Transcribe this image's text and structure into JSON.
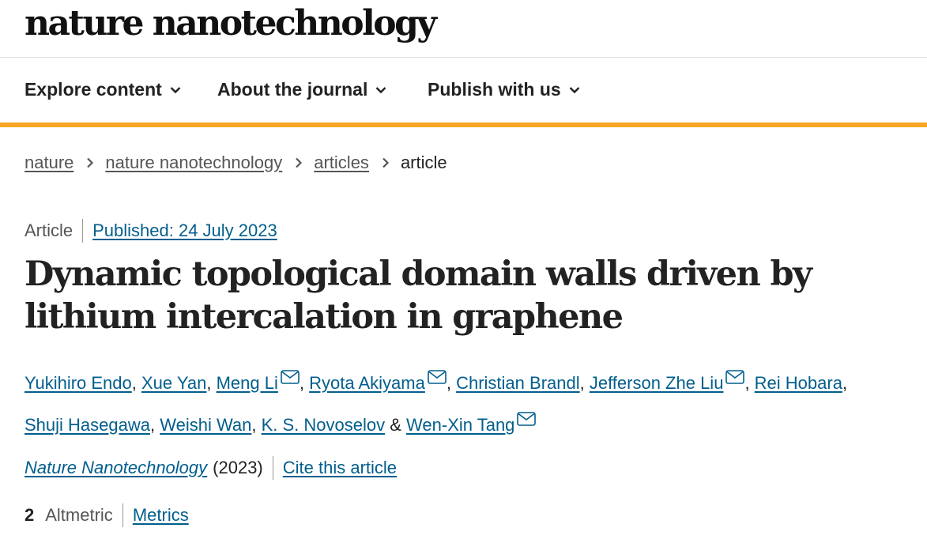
{
  "header": {
    "logo": "nature nanotechnology"
  },
  "nav": {
    "items": [
      {
        "label": "Explore content"
      },
      {
        "label": "About the journal"
      },
      {
        "label": "Publish with us"
      }
    ],
    "accent_color": "#f5a623"
  },
  "breadcrumb": {
    "items": [
      "nature",
      "nature nanotechnology",
      "articles"
    ],
    "current": "article"
  },
  "article": {
    "type": "Article",
    "published": "Published: 24 July 2023",
    "title": "Dynamic topological domain walls driven by lithium intercalation in graphene",
    "authors": [
      {
        "name": "Yukihiro Endo",
        "mail": false,
        "sep": ", "
      },
      {
        "name": "Xue Yan",
        "mail": false,
        "sep": ", "
      },
      {
        "name": "Meng Li",
        "mail": true,
        "sep": ", "
      },
      {
        "name": "Ryota Akiyama",
        "mail": true,
        "sep": ", "
      },
      {
        "name": "Christian Brandl",
        "mail": false,
        "sep": ", "
      },
      {
        "name": "Jefferson Zhe Liu",
        "mail": true,
        "sep": ", "
      },
      {
        "name": "Rei Hobara",
        "mail": false,
        "sep": ", "
      },
      {
        "name": "Shuji Hasegawa",
        "mail": false,
        "sep": ", "
      },
      {
        "name": "Weishi Wan",
        "mail": false,
        "sep": ", "
      },
      {
        "name": "K. S. Novoselov",
        "mail": false,
        "sep": " & "
      },
      {
        "name": "Wen-Xin Tang",
        "mail": true,
        "sep": ""
      }
    ],
    "journal": "Nature Nanotechnology",
    "year": "(2023)",
    "cite_label": "Cite this article",
    "altmetric_score": "2",
    "altmetric_label": "Altmetric",
    "metrics_label": "Metrics"
  },
  "colors": {
    "link": "#025e8d",
    "text": "#222222",
    "muted": "#555555"
  },
  "icons": {
    "nav_chevron": "chevron-down-icon",
    "breadcrumb_sep": "chevron-right-icon",
    "author_mail": "mail-icon"
  }
}
